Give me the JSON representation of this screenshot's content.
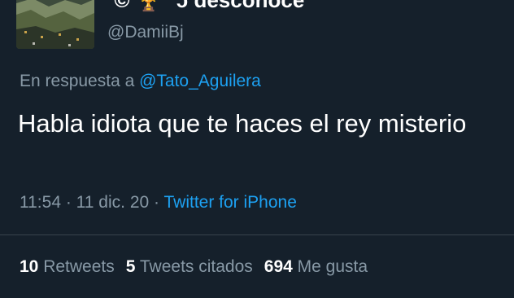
{
  "tweet": {
    "display_name": "°© 🏆 °ɔ desconoce",
    "handle": "@DamiiBj",
    "reply_prefix": "En respuesta a ",
    "reply_to": "@Tato_Aguilera",
    "text": "Habla idiota que te haces el rey misterio",
    "time": "11:54",
    "sep1": " · ",
    "date": "11 dic. 20",
    "sep2": " · ",
    "source": "Twitter for iPhone"
  },
  "stats": {
    "retweets_count": "10",
    "retweets_label": " Retweets",
    "quotes_count": "5",
    "quotes_label": " Tweets citados",
    "likes_count": "694",
    "likes_label": " Me gusta"
  },
  "colors": {
    "background": "#15202b",
    "text": "#ffffff",
    "secondary": "#8899a6",
    "link": "#1da1f2",
    "divider": "#38444d"
  }
}
